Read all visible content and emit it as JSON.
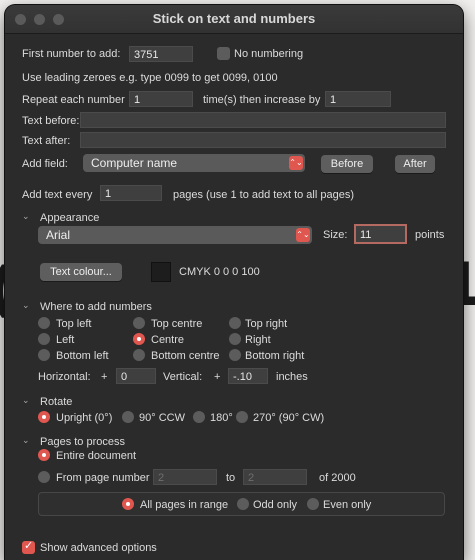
{
  "window": {
    "title": "Stick on text and numbers"
  },
  "numbering": {
    "first_label": "First number to add:",
    "first_value": "3751",
    "no_numbering_label": "No numbering",
    "leading_hint": "Use leading zeroes e.g. type 0099 to get 0099, 0100",
    "repeat_label": "Repeat each number",
    "repeat_value": "1",
    "times_label": "time(s) then increase by",
    "increase_value": "1",
    "before_label": "Text before:",
    "after_label": "Text after:",
    "add_field_label": "Add field:",
    "add_field_value": "Computer name",
    "before_button": "Before",
    "after_button": "After",
    "every_label": "Add text every",
    "every_value": "1",
    "every_suffix": "pages (use 1 to add text to all pages)"
  },
  "appearance": {
    "header": "Appearance",
    "font": "Arial",
    "size_label": "Size:",
    "size_value": "11",
    "size_unit": "points",
    "text_colour_button": "Text colour...",
    "colour_value": "CMYK 0 0 0 100",
    "colour_swatch": "#1d1d1d"
  },
  "position": {
    "header": "Where to add numbers",
    "options": [
      "Top left",
      "Top centre",
      "Top right",
      "Left",
      "Centre",
      "Right",
      "Bottom left",
      "Bottom centre",
      "Bottom right"
    ],
    "selected": "Centre",
    "horizontal_label": "Horizontal:",
    "horizontal_sign": "+",
    "horizontal_value": "0",
    "vertical_label": "Vertical:",
    "vertical_sign": "+",
    "vertical_value": "-.10",
    "offset_unit": "inches"
  },
  "rotate": {
    "header": "Rotate",
    "options": [
      "Upright (0°)",
      "90° CCW",
      "180°",
      "270° (90° CW)"
    ],
    "selected": "Upright (0°)"
  },
  "pages": {
    "header": "Pages to process",
    "entire_label": "Entire document",
    "from_label": "From page number",
    "from_value": "2",
    "to_label": "to",
    "to_value": "2",
    "of_label": "of 2000",
    "range_options": [
      "All pages in range",
      "Odd only",
      "Even only"
    ],
    "range_selected": "All pages in range"
  },
  "advanced": {
    "label": "Show advanced options",
    "checked": true
  },
  "colors": {
    "accent": "#e0574f",
    "window_bg": "#2b2b2b"
  }
}
